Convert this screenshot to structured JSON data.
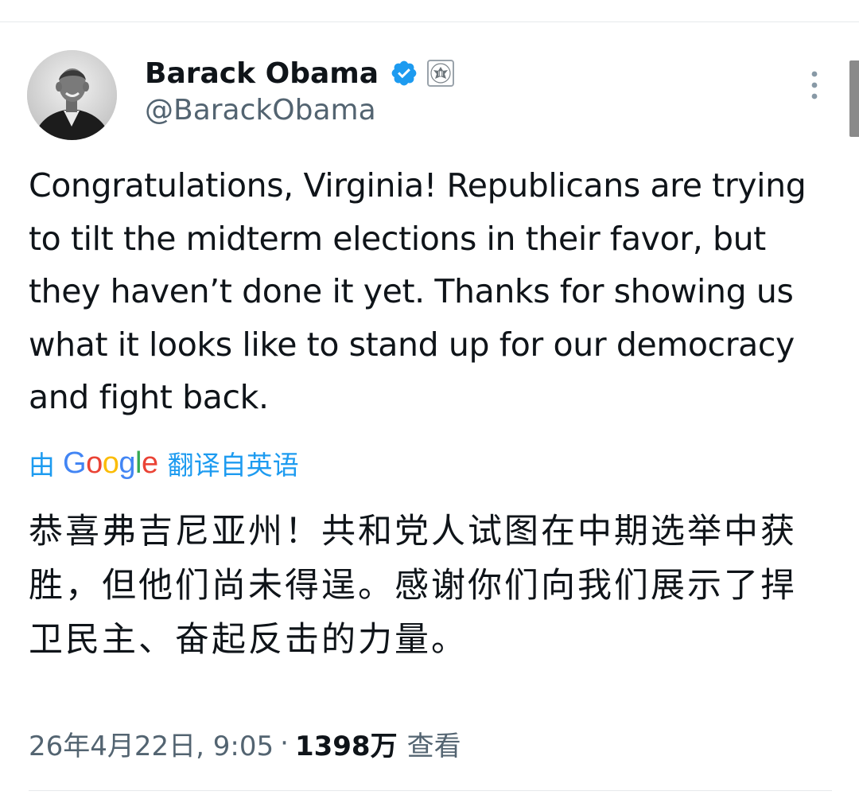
{
  "tweet": {
    "author": {
      "display_name": "Barack Obama",
      "handle": "@BarackObama",
      "verified": true,
      "avatar_icon": "profile-photo"
    },
    "text": "Congratulations, Virginia! Republicans are trying to tilt the midterm elections in their favor, but they haven’t done it yet. Thanks for showing us what it looks like to stand up for our democracy and fight back.",
    "translation": {
      "by_label": "由",
      "provider": "Google",
      "suffix_label": "翻译自英语",
      "text": "恭喜弗吉尼亚州！共和党人试图在中期选举中获胜，但他们尚未得逞。感谢你们向我们展示了捍卫民主、奋起反击的力量。"
    },
    "meta": {
      "timestamp": "26年4月22日, 9:05",
      "separator": "·",
      "views_count": "1398万",
      "views_label": "查看"
    }
  },
  "colors": {
    "accent": "#1d9bf0",
    "text_primary": "#0f1419",
    "text_secondary": "#536471",
    "divider": "#e6e9ec"
  }
}
